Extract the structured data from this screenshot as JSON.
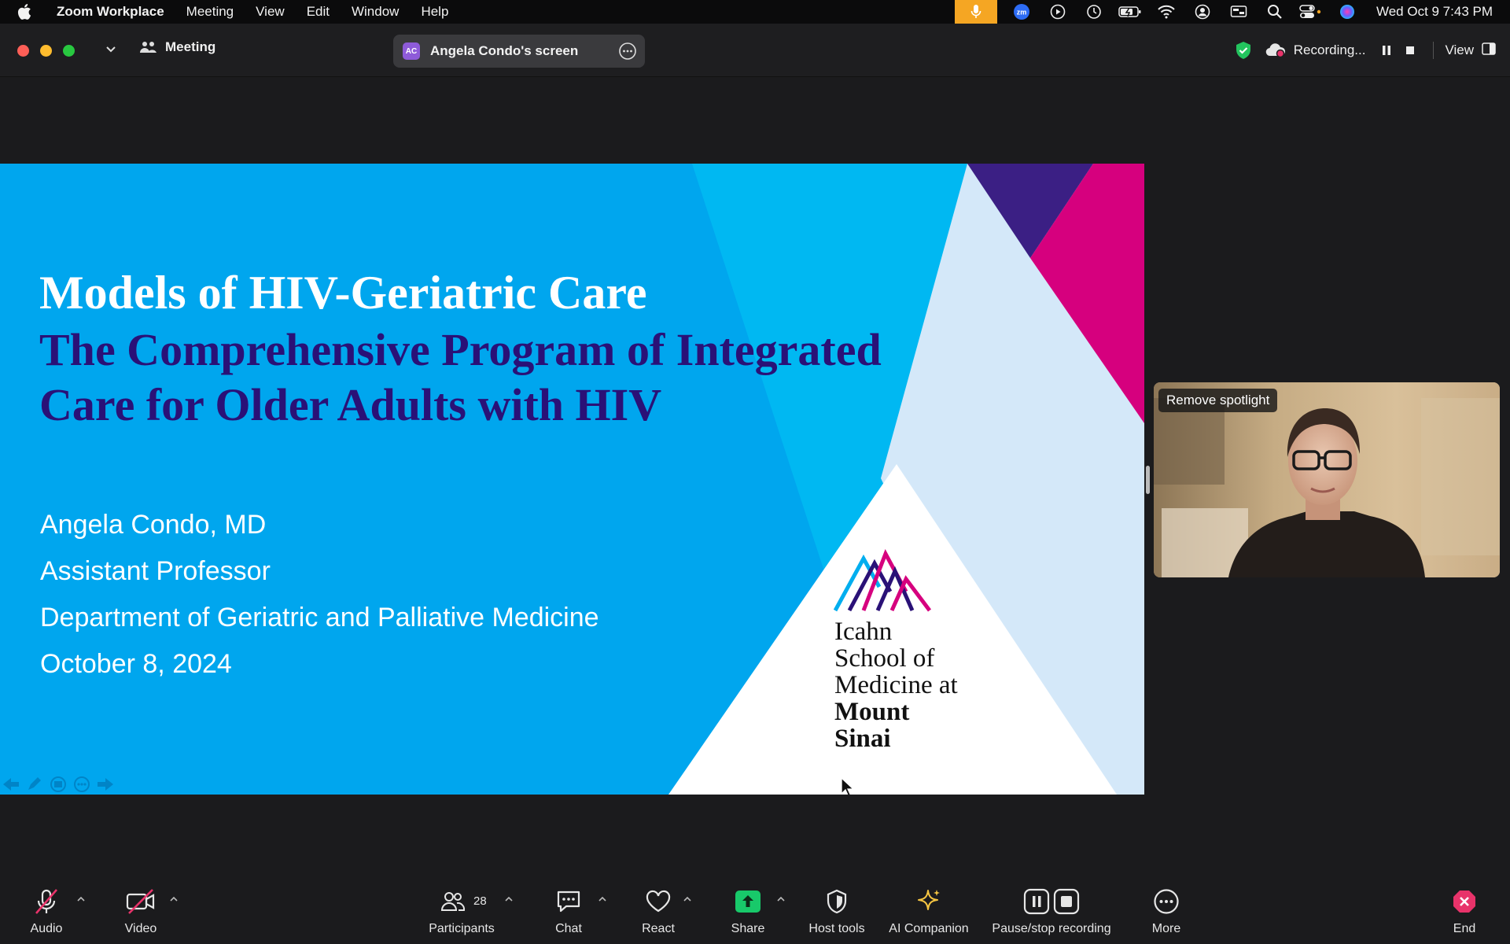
{
  "menubar": {
    "app_name": "Zoom Workplace",
    "items": [
      "Meeting",
      "View",
      "Edit",
      "Window",
      "Help"
    ],
    "clock": "Wed Oct 9  7:43 PM"
  },
  "titlebar": {
    "meeting_label": "Meeting",
    "screen_initials": "AC",
    "screen_label": "Angela Condo's screen",
    "recording_label": "Recording...",
    "view_label": "View"
  },
  "slide": {
    "line1": "Models of HIV-Geriatric Care",
    "line2": "The Comprehensive Program of Integrated",
    "line3": "Care for Older Adults with HIV",
    "presenter": "Angela Condo, MD",
    "role": "Assistant Professor",
    "department": "Department of Geriatric and Palliative Medicine",
    "date": "October 8, 2024",
    "logo_lines": [
      "Icahn",
      "School of",
      "Medicine at",
      "Mount",
      "Sinai"
    ]
  },
  "video_tile": {
    "spotlight_button": "Remove spotlight"
  },
  "toolbar": {
    "audio": "Audio",
    "video": "Video",
    "participants": "Participants",
    "participants_count": "28",
    "chat": "Chat",
    "react": "React",
    "share": "Share",
    "host_tools": "Host tools",
    "ai_companion": "AI Companion",
    "pause_stop": "Pause/stop recording",
    "more": "More",
    "end": "End"
  },
  "colors": {
    "slide_blue": "#00a6ee",
    "slide_title_dark": "#2a1177",
    "magenta": "#d6007e",
    "share_green": "#18c96a",
    "end_red": "#e8336a",
    "ai_gold": "#f5c542"
  }
}
